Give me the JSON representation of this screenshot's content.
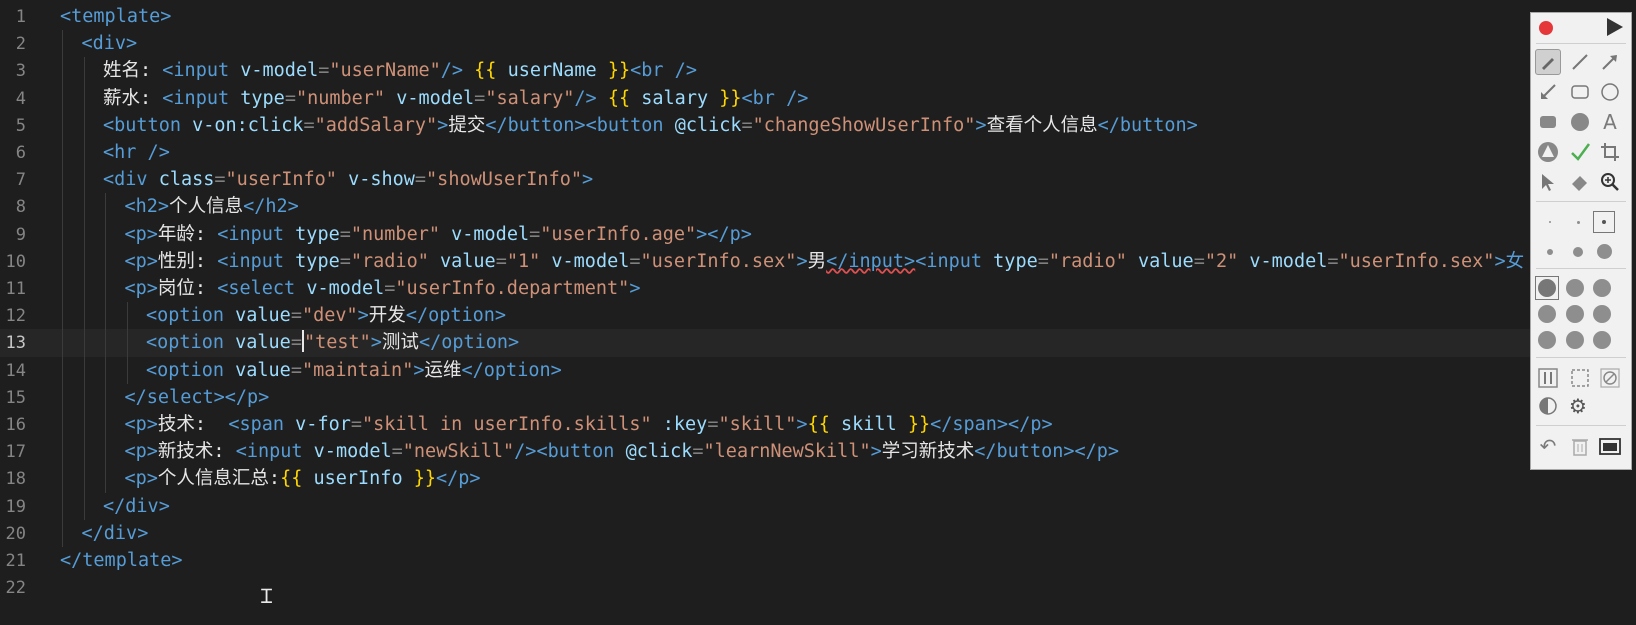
{
  "editor": {
    "current_line": 13,
    "lines": [
      {
        "n": "1",
        "indent": 0,
        "tokens": [
          {
            "t": "<template>",
            "c": "tag"
          }
        ]
      },
      {
        "n": "2",
        "indent": 1,
        "tokens": [
          {
            "t": "<div>",
            "c": "tag"
          }
        ]
      },
      {
        "n": "3",
        "indent": 2,
        "tokens": [
          {
            "t": "姓名: ",
            "c": "text"
          },
          {
            "t": "<input ",
            "c": "tag"
          },
          {
            "t": "v-model",
            "c": "attr"
          },
          {
            "t": "=",
            "c": "p"
          },
          {
            "t": "\"userName\"",
            "c": "str"
          },
          {
            "t": "/> ",
            "c": "tag"
          },
          {
            "t": "{{",
            "c": "brace"
          },
          {
            "t": " userName ",
            "c": "attr"
          },
          {
            "t": "}}",
            "c": "brace"
          },
          {
            "t": "<br />",
            "c": "tag"
          }
        ]
      },
      {
        "n": "4",
        "indent": 2,
        "tokens": [
          {
            "t": "薪水: ",
            "c": "text"
          },
          {
            "t": "<input ",
            "c": "tag"
          },
          {
            "t": "type",
            "c": "attr"
          },
          {
            "t": "=",
            "c": "p"
          },
          {
            "t": "\"number\"",
            "c": "str"
          },
          {
            "t": " ",
            "c": "p"
          },
          {
            "t": "v-model",
            "c": "attr"
          },
          {
            "t": "=",
            "c": "p"
          },
          {
            "t": "\"salary\"",
            "c": "str"
          },
          {
            "t": "/> ",
            "c": "tag"
          },
          {
            "t": "{{",
            "c": "brace"
          },
          {
            "t": " salary ",
            "c": "attr"
          },
          {
            "t": "}}",
            "c": "brace"
          },
          {
            "t": "<br />",
            "c": "tag"
          }
        ]
      },
      {
        "n": "5",
        "indent": 2,
        "tokens": [
          {
            "t": "<button ",
            "c": "tag"
          },
          {
            "t": "v-on:click",
            "c": "attr"
          },
          {
            "t": "=",
            "c": "p"
          },
          {
            "t": "\"addSalary\"",
            "c": "str"
          },
          {
            "t": ">",
            "c": "tag"
          },
          {
            "t": "提交",
            "c": "text"
          },
          {
            "t": "</button><button ",
            "c": "tag"
          },
          {
            "t": "@click",
            "c": "attr"
          },
          {
            "t": "=",
            "c": "p"
          },
          {
            "t": "\"changeShowUserInfo\"",
            "c": "str"
          },
          {
            "t": ">",
            "c": "tag"
          },
          {
            "t": "查看个人信息",
            "c": "text"
          },
          {
            "t": "</button>",
            "c": "tag"
          }
        ]
      },
      {
        "n": "6",
        "indent": 2,
        "tokens": [
          {
            "t": "<hr />",
            "c": "tag"
          }
        ]
      },
      {
        "n": "7",
        "indent": 2,
        "tokens": [
          {
            "t": "<div ",
            "c": "tag"
          },
          {
            "t": "class",
            "c": "attr"
          },
          {
            "t": "=",
            "c": "p"
          },
          {
            "t": "\"userInfo\"",
            "c": "str"
          },
          {
            "t": " ",
            "c": "p"
          },
          {
            "t": "v-show",
            "c": "attr"
          },
          {
            "t": "=",
            "c": "p"
          },
          {
            "t": "\"showUserInfo\"",
            "c": "str"
          },
          {
            "t": ">",
            "c": "tag"
          }
        ]
      },
      {
        "n": "8",
        "indent": 3,
        "tokens": [
          {
            "t": "<h2>",
            "c": "tag"
          },
          {
            "t": "个人信息",
            "c": "text"
          },
          {
            "t": "</h2>",
            "c": "tag"
          }
        ]
      },
      {
        "n": "9",
        "indent": 3,
        "tokens": [
          {
            "t": "<p>",
            "c": "tag"
          },
          {
            "t": "年龄: ",
            "c": "text"
          },
          {
            "t": "<input ",
            "c": "tag"
          },
          {
            "t": "type",
            "c": "attr"
          },
          {
            "t": "=",
            "c": "p"
          },
          {
            "t": "\"number\"",
            "c": "str"
          },
          {
            "t": " ",
            "c": "p"
          },
          {
            "t": "v-model",
            "c": "attr"
          },
          {
            "t": "=",
            "c": "p"
          },
          {
            "t": "\"userInfo.age\"",
            "c": "str"
          },
          {
            "t": "></p>",
            "c": "tag"
          }
        ]
      },
      {
        "n": "10",
        "indent": 3,
        "tokens": [
          {
            "t": "<p>",
            "c": "tag"
          },
          {
            "t": "性别: ",
            "c": "text"
          },
          {
            "t": "<input ",
            "c": "tag"
          },
          {
            "t": "type",
            "c": "attr"
          },
          {
            "t": "=",
            "c": "p"
          },
          {
            "t": "\"radio\"",
            "c": "str"
          },
          {
            "t": " ",
            "c": "p"
          },
          {
            "t": "value",
            "c": "attr"
          },
          {
            "t": "=",
            "c": "p"
          },
          {
            "t": "\"1\"",
            "c": "str"
          },
          {
            "t": " ",
            "c": "p"
          },
          {
            "t": "v-model",
            "c": "attr"
          },
          {
            "t": "=",
            "c": "p"
          },
          {
            "t": "\"userInfo.sex\"",
            "c": "str"
          },
          {
            "t": ">",
            "c": "tag"
          },
          {
            "t": "男",
            "c": "text"
          },
          {
            "t": "</input>",
            "c": "tag",
            "sq": true
          },
          {
            "t": "<input ",
            "c": "tag"
          },
          {
            "t": "type",
            "c": "attr"
          },
          {
            "t": "=",
            "c": "p"
          },
          {
            "t": "\"radio\"",
            "c": "str"
          },
          {
            "t": " ",
            "c": "p"
          },
          {
            "t": "value",
            "c": "attr"
          },
          {
            "t": "=",
            "c": "p"
          },
          {
            "t": "\"2\"",
            "c": "str"
          },
          {
            "t": " ",
            "c": "p"
          },
          {
            "t": "v-model",
            "c": "attr"
          },
          {
            "t": "=",
            "c": "p"
          },
          {
            "t": "\"userInfo.sex\"",
            "c": "str"
          },
          {
            "t": ">女",
            "c": "tag"
          }
        ]
      },
      {
        "n": "11",
        "indent": 3,
        "tokens": [
          {
            "t": "<p>",
            "c": "tag"
          },
          {
            "t": "岗位: ",
            "c": "text"
          },
          {
            "t": "<select ",
            "c": "tag"
          },
          {
            "t": "v-model",
            "c": "attr"
          },
          {
            "t": "=",
            "c": "p"
          },
          {
            "t": "\"userInfo.department\"",
            "c": "str"
          },
          {
            "t": ">",
            "c": "tag"
          }
        ]
      },
      {
        "n": "12",
        "indent": 4,
        "tokens": [
          {
            "t": "<option ",
            "c": "tag"
          },
          {
            "t": "value",
            "c": "attr"
          },
          {
            "t": "=",
            "c": "p"
          },
          {
            "t": "\"dev\"",
            "c": "str"
          },
          {
            "t": ">",
            "c": "tag"
          },
          {
            "t": "开发",
            "c": "text"
          },
          {
            "t": "</option>",
            "c": "tag"
          }
        ]
      },
      {
        "n": "13",
        "indent": 4,
        "tokens": [
          {
            "t": "<option ",
            "c": "tag"
          },
          {
            "t": "value",
            "c": "attr"
          },
          {
            "t": "=",
            "c": "p"
          },
          {
            "t": "CARET",
            "c": "caret"
          },
          {
            "t": "\"test\"",
            "c": "str"
          },
          {
            "t": ">",
            "c": "tag"
          },
          {
            "t": "测试",
            "c": "text"
          },
          {
            "t": "</option>",
            "c": "tag"
          }
        ]
      },
      {
        "n": "14",
        "indent": 4,
        "tokens": [
          {
            "t": "<option ",
            "c": "tag"
          },
          {
            "t": "value",
            "c": "attr"
          },
          {
            "t": "=",
            "c": "p"
          },
          {
            "t": "\"maintain\"",
            "c": "str"
          },
          {
            "t": ">",
            "c": "tag"
          },
          {
            "t": "运维",
            "c": "text"
          },
          {
            "t": "</option>",
            "c": "tag"
          }
        ]
      },
      {
        "n": "15",
        "indent": 3,
        "tokens": [
          {
            "t": "</select></p>",
            "c": "tag"
          }
        ]
      },
      {
        "n": "16",
        "indent": 3,
        "tokens": [
          {
            "t": "<p>",
            "c": "tag"
          },
          {
            "t": "技术:  ",
            "c": "text"
          },
          {
            "t": "<span ",
            "c": "tag"
          },
          {
            "t": "v-for",
            "c": "attr"
          },
          {
            "t": "=",
            "c": "p"
          },
          {
            "t": "\"skill in userInfo.skills\"",
            "c": "str"
          },
          {
            "t": " ",
            "c": "p"
          },
          {
            "t": ":key",
            "c": "attr"
          },
          {
            "t": "=",
            "c": "p"
          },
          {
            "t": "\"skill\"",
            "c": "str"
          },
          {
            "t": ">",
            "c": "tag"
          },
          {
            "t": "{{",
            "c": "brace"
          },
          {
            "t": " skill ",
            "c": "attr"
          },
          {
            "t": "}}",
            "c": "brace"
          },
          {
            "t": "</span></p>",
            "c": "tag"
          }
        ]
      },
      {
        "n": "17",
        "indent": 3,
        "tokens": [
          {
            "t": "<p>",
            "c": "tag"
          },
          {
            "t": "新技术: ",
            "c": "text"
          },
          {
            "t": "<input ",
            "c": "tag"
          },
          {
            "t": "v-model",
            "c": "attr"
          },
          {
            "t": "=",
            "c": "p"
          },
          {
            "t": "\"newSkill\"",
            "c": "str"
          },
          {
            "t": "/><button ",
            "c": "tag"
          },
          {
            "t": "@click",
            "c": "attr"
          },
          {
            "t": "=",
            "c": "p"
          },
          {
            "t": "\"learnNewSkill\"",
            "c": "str"
          },
          {
            "t": ">",
            "c": "tag"
          },
          {
            "t": "学习新技术",
            "c": "text"
          },
          {
            "t": "</button></p>",
            "c": "tag"
          }
        ]
      },
      {
        "n": "18",
        "indent": 3,
        "tokens": [
          {
            "t": "<p>",
            "c": "tag"
          },
          {
            "t": "个人信息汇总:",
            "c": "text"
          },
          {
            "t": "{{",
            "c": "brace"
          },
          {
            "t": " userInfo ",
            "c": "attr"
          },
          {
            "t": "}}",
            "c": "brace"
          },
          {
            "t": "</p>",
            "c": "tag"
          }
        ]
      },
      {
        "n": "19",
        "indent": 2,
        "tokens": [
          {
            "t": "</div>",
            "c": "tag"
          }
        ]
      },
      {
        "n": "20",
        "indent": 1,
        "tokens": [
          {
            "t": "</div>",
            "c": "tag"
          }
        ]
      },
      {
        "n": "21",
        "indent": 0,
        "tokens": [
          {
            "t": "</template>",
            "c": "tag"
          }
        ]
      },
      {
        "n": "22",
        "indent": 0,
        "tokens": []
      }
    ]
  },
  "colors": {
    "background": "#1e1e1e",
    "tag": "#569cd6",
    "attribute": "#9cdcfe",
    "string": "#ce9178",
    "brace": "#ffd700",
    "text": "#e6e6e6",
    "record": "#e5373a",
    "check": "#4caf50"
  },
  "palette": {
    "tools": [
      "record-icon",
      "play-icon",
      "brush-icon",
      "line-icon",
      "arrow-icon",
      "arrow-reverse-icon",
      "rounded-rect-icon",
      "circle-icon",
      "filled-rect-icon",
      "filled-circle-icon",
      "text-icon",
      "blur-icon",
      "check-icon",
      "crop-icon",
      "pointer-icon",
      "eraser-icon",
      "zoom-icon",
      "undo-icon",
      "trash-icon",
      "save-icon",
      "settings-icon",
      "contrast-icon"
    ]
  }
}
